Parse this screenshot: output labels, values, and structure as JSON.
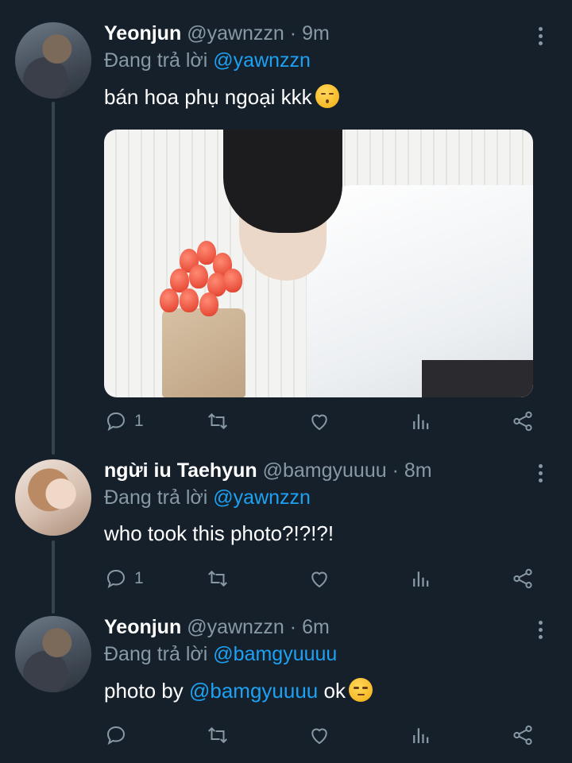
{
  "tweets": [
    {
      "name": "Yeonjun",
      "handle": "@yawnzzn",
      "time": "9m",
      "replying_label": "Đang trả lời",
      "replying_to": "@yawnzzn",
      "text": "bán hoa phụ ngoại kkk",
      "emoji": "kissing-face-emoji",
      "reply_count": "1",
      "retweet_count": "",
      "like_count": ""
    },
    {
      "name": "ngừi iu Taehyun",
      "handle": "@bamgyuuuu",
      "time": "8m",
      "replying_label": "Đang trả lời",
      "replying_to": "@yawnzzn",
      "text": "who took this photo?!?!?!",
      "reply_count": "1",
      "retweet_count": "",
      "like_count": ""
    },
    {
      "name": "Yeonjun",
      "handle": "@yawnzzn",
      "time": "6m",
      "replying_label": "Đang trả lời",
      "replying_to": "@bamgyuuuu",
      "text_prefix": "photo by",
      "text_mention": "@bamgyuuuu",
      "text_suffix": "ok",
      "emoji": "unamused-face-emoji",
      "reply_count": "",
      "retweet_count": "",
      "like_count": ""
    }
  ],
  "separator": "·",
  "icons": [
    "reply-icon",
    "retweet-icon",
    "like-icon",
    "analytics-icon",
    "share-icon",
    "more-options-icon"
  ],
  "colors": {
    "background": "#15202b",
    "primary_text": "#ffffff",
    "secondary_text": "#8899a6",
    "accent": "#1da1f2",
    "thread_line": "#38444d"
  }
}
